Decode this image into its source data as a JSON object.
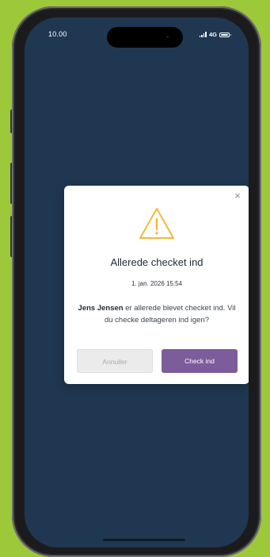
{
  "status_bar": {
    "time": "10.00",
    "network": "4G"
  },
  "dialog": {
    "close_icon": "×",
    "icon": "warning-icon",
    "title": "Allerede checket ind",
    "date": "1. jan. 2026 15:54",
    "message_name": "Jens Jensen",
    "message_text": " er allerede blevet checket ind. Vil du checke deltageren ind igen?",
    "cancel_label": "Annuller",
    "confirm_label": "Check ind"
  },
  "colors": {
    "background": "#9cc83a",
    "screen": "#203751",
    "warning": "#f4b83a",
    "primary_button": "#7d5c9b",
    "cancel_button": "#ebebeb"
  }
}
